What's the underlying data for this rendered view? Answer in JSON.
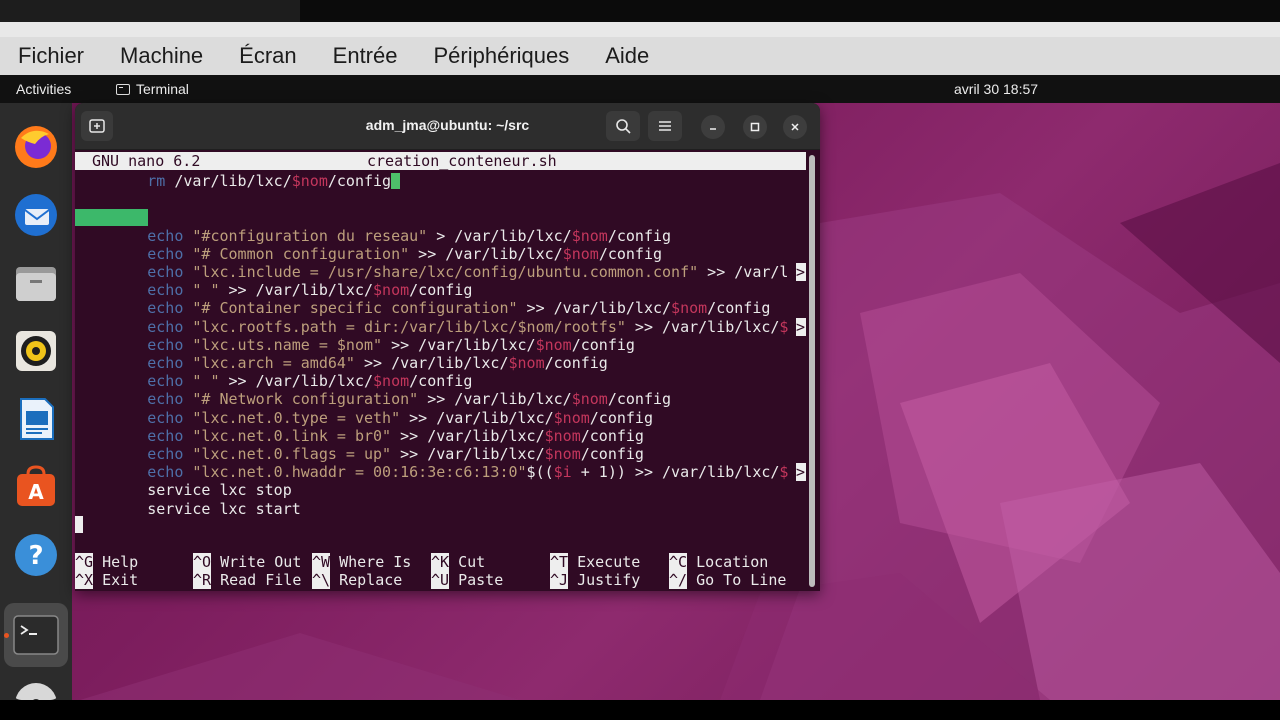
{
  "vbox_menu": [
    "Fichier",
    "Machine",
    "Écran",
    "Entrée",
    "Périphériques",
    "Aide"
  ],
  "topbar": {
    "activities": "Activities",
    "app_name": "Terminal",
    "clock": "avril 30  18:57"
  },
  "dock": [
    {
      "name": "firefox-icon"
    },
    {
      "name": "thunderbird-icon"
    },
    {
      "name": "files-icon"
    },
    {
      "name": "rhythmbox-icon"
    },
    {
      "name": "writer-icon"
    },
    {
      "name": "app-center-icon"
    },
    {
      "name": "help-icon"
    },
    {
      "name": "terminal-icon"
    },
    {
      "name": "disc-icon"
    }
  ],
  "window": {
    "title": "adm_jma@ubuntu: ~/src"
  },
  "nano": {
    "version": "GNU nano 6.2",
    "filename": "creation_conteneur.sh",
    "lines": [
      [
        {
          "t": "        "
        },
        {
          "t": "rm",
          "c": "kw"
        },
        {
          "t": " /var/lib/lxc/"
        },
        {
          "t": "$nom",
          "c": "var"
        },
        {
          "t": "/config"
        }
      ],
      [],
      [],
      [
        {
          "t": "        "
        },
        {
          "t": "echo",
          "c": "kw"
        },
        {
          "t": " "
        },
        {
          "t": "\"#configuration du reseau\"",
          "c": "str"
        },
        {
          "t": " > /var/lib/lxc/"
        },
        {
          "t": "$nom",
          "c": "var"
        },
        {
          "t": "/config"
        }
      ],
      [
        {
          "t": "        "
        },
        {
          "t": "echo",
          "c": "kw"
        },
        {
          "t": " "
        },
        {
          "t": "\"# Common configuration\"",
          "c": "str"
        },
        {
          "t": " >> /var/lib/lxc/"
        },
        {
          "t": "$nom",
          "c": "var"
        },
        {
          "t": "/config"
        }
      ],
      [
        {
          "t": "        "
        },
        {
          "t": "echo",
          "c": "kw"
        },
        {
          "t": " "
        },
        {
          "t": "\"lxc.include = /usr/share/lxc/config/ubuntu.common.conf\"",
          "c": "str"
        },
        {
          "t": " >> /var/l"
        }
      ],
      [
        {
          "t": "        "
        },
        {
          "t": "echo",
          "c": "kw"
        },
        {
          "t": " "
        },
        {
          "t": "\" \"",
          "c": "str"
        },
        {
          "t": " >> /var/lib/lxc/"
        },
        {
          "t": "$nom",
          "c": "var"
        },
        {
          "t": "/config"
        }
      ],
      [
        {
          "t": "        "
        },
        {
          "t": "echo",
          "c": "kw"
        },
        {
          "t": " "
        },
        {
          "t": "\"# Container specific configuration\"",
          "c": "str"
        },
        {
          "t": " >> /var/lib/lxc/"
        },
        {
          "t": "$nom",
          "c": "var"
        },
        {
          "t": "/config"
        }
      ],
      [
        {
          "t": "        "
        },
        {
          "t": "echo",
          "c": "kw"
        },
        {
          "t": " "
        },
        {
          "t": "\"lxc.rootfs.path = dir:/var/lib/lxc/$nom/rootfs\"",
          "c": "str"
        },
        {
          "t": " >> /var/lib/lxc/"
        },
        {
          "t": "$",
          "c": "var"
        }
      ],
      [
        {
          "t": "        "
        },
        {
          "t": "echo",
          "c": "kw"
        },
        {
          "t": " "
        },
        {
          "t": "\"lxc.uts.name = $nom\"",
          "c": "str"
        },
        {
          "t": " >> /var/lib/lxc/"
        },
        {
          "t": "$nom",
          "c": "var"
        },
        {
          "t": "/config"
        }
      ],
      [
        {
          "t": "        "
        },
        {
          "t": "echo",
          "c": "kw"
        },
        {
          "t": " "
        },
        {
          "t": "\"lxc.arch = amd64\"",
          "c": "str"
        },
        {
          "t": " >> /var/lib/lxc/"
        },
        {
          "t": "$nom",
          "c": "var"
        },
        {
          "t": "/config"
        }
      ],
      [
        {
          "t": "        "
        },
        {
          "t": "echo",
          "c": "kw"
        },
        {
          "t": " "
        },
        {
          "t": "\" \"",
          "c": "str"
        },
        {
          "t": " >> /var/lib/lxc/"
        },
        {
          "t": "$nom",
          "c": "var"
        },
        {
          "t": "/config"
        }
      ],
      [
        {
          "t": "        "
        },
        {
          "t": "echo",
          "c": "kw"
        },
        {
          "t": " "
        },
        {
          "t": "\"# Network configuration\"",
          "c": "str"
        },
        {
          "t": " >> /var/lib/lxc/"
        },
        {
          "t": "$nom",
          "c": "var"
        },
        {
          "t": "/config"
        }
      ],
      [
        {
          "t": "        "
        },
        {
          "t": "echo",
          "c": "kw"
        },
        {
          "t": " "
        },
        {
          "t": "\"lxc.net.0.type = veth\"",
          "c": "str"
        },
        {
          "t": " >> /var/lib/lxc/"
        },
        {
          "t": "$nom",
          "c": "var"
        },
        {
          "t": "/config"
        }
      ],
      [
        {
          "t": "        "
        },
        {
          "t": "echo",
          "c": "kw"
        },
        {
          "t": " "
        },
        {
          "t": "\"lxc.net.0.link = br0\"",
          "c": "str"
        },
        {
          "t": " >> /var/lib/lxc/"
        },
        {
          "t": "$nom",
          "c": "var"
        },
        {
          "t": "/config"
        }
      ],
      [
        {
          "t": "        "
        },
        {
          "t": "echo",
          "c": "kw"
        },
        {
          "t": " "
        },
        {
          "t": "\"lxc.net.0.flags = up\"",
          "c": "str"
        },
        {
          "t": " >> /var/lib/lxc/"
        },
        {
          "t": "$nom",
          "c": "var"
        },
        {
          "t": "/config"
        }
      ],
      [
        {
          "t": "        "
        },
        {
          "t": "echo",
          "c": "kw"
        },
        {
          "t": " "
        },
        {
          "t": "\"lxc.net.0.hwaddr = 00:16:3e:c6:13:0\"",
          "c": "str"
        },
        {
          "t": "$(("
        },
        {
          "t": "$i",
          "c": "var"
        },
        {
          "t": " + 1)) >> /var/lib/lxc/"
        },
        {
          "t": "$",
          "c": "var"
        }
      ],
      [
        {
          "t": "        service lxc stop"
        }
      ],
      [
        {
          "t": "        service lxc start"
        }
      ]
    ],
    "overflow_lines": [
      5,
      8,
      16
    ],
    "shortcuts": [
      [
        {
          "k": "^G",
          "l": " Help"
        },
        {
          "k": "^O",
          "l": " Write Out"
        },
        {
          "k": "^W",
          "l": " Where Is"
        },
        {
          "k": "^K",
          "l": " Cut"
        },
        {
          "k": "^T",
          "l": " Execute"
        },
        {
          "k": "^C",
          "l": " Location"
        }
      ],
      [
        {
          "k": "^X",
          "l": " Exit"
        },
        {
          "k": "^R",
          "l": " Read File"
        },
        {
          "k": "^\\",
          "l": " Replace"
        },
        {
          "k": "^U",
          "l": " Paste"
        },
        {
          "k": "^J",
          "l": " Justify"
        },
        {
          "k": "^/",
          "l": " Go To Line"
        }
      ]
    ]
  },
  "colors": {
    "terminal_bg": "#300a24",
    "keyword": "#4e6fa8",
    "string": "#bd9f7c",
    "variable": "#c3365c",
    "cursor": "#4ec06a",
    "desktop": "#7c1d5d"
  }
}
